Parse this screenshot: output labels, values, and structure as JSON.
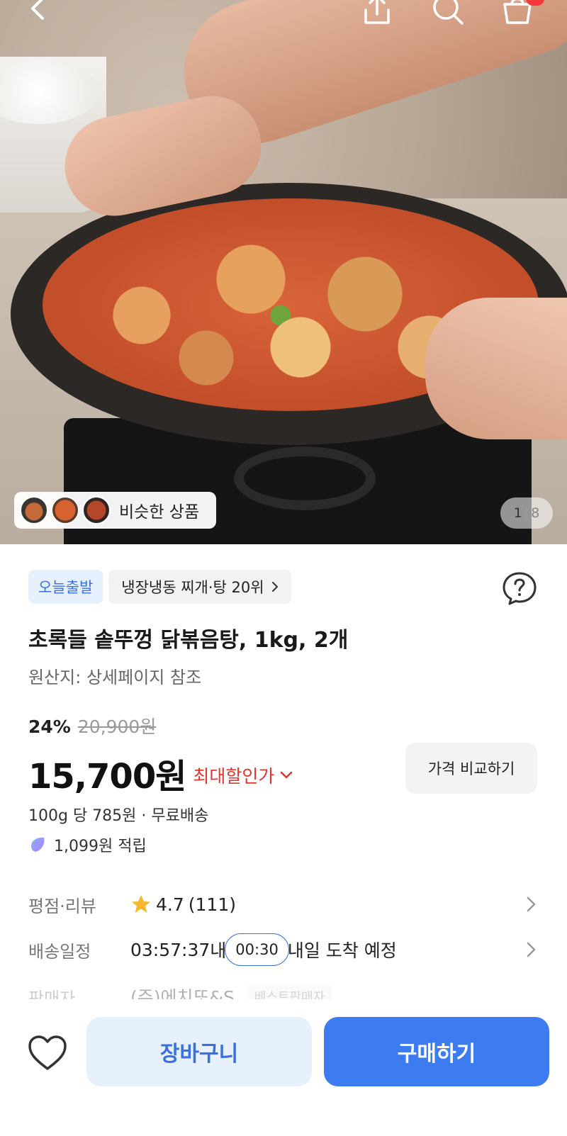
{
  "header": {
    "back_icon": "chevron-left-icon",
    "share_icon": "share-icon",
    "search_icon": "search-icon",
    "cart_icon": "cart-icon"
  },
  "gallery": {
    "similar_label": "비슷한 상품",
    "current_page": "1",
    "separator": "|",
    "total_pages": "8"
  },
  "product": {
    "delivery_badge": "오늘출발",
    "ranking_badge": "냉장냉동 찌개·탕 20위",
    "title": "초록들 솥뚜껑 닭볶음탕, 1kg, 2개",
    "origin": "원산지: 상세페이지 참조",
    "discount_percent": "24%",
    "original_price": "20,900원",
    "price": "15,700원",
    "max_discount_label": "최대할인가",
    "compare_button": "가격 비교하기",
    "unit_price_shipping": "100g 당 785원 · 무료배송",
    "reward_points": "1,099원 적립"
  },
  "info_rows": {
    "rating": {
      "label": "평점·리뷰",
      "score": "4.7",
      "count": "(111)"
    },
    "delivery": {
      "label": "배송일정",
      "countdown": "03:57:37",
      "within": "내",
      "timer": "00:30",
      "arrival": "내일 도착 예정"
    },
    "seller": {
      "label": "판매자",
      "name": "(주)에치또&S",
      "badge": "베스트판매자"
    }
  },
  "bottom_bar": {
    "wishlist_icon": "heart-icon",
    "cart_button": "장바구니",
    "buy_button": "구매하기"
  },
  "colors": {
    "accent_blue": "#3d7bf0",
    "accent_blue_light": "#e7f0fd",
    "discount_red": "#e0362c",
    "star_yellow": "#f5b82e",
    "badge_red": "#f5383b"
  }
}
